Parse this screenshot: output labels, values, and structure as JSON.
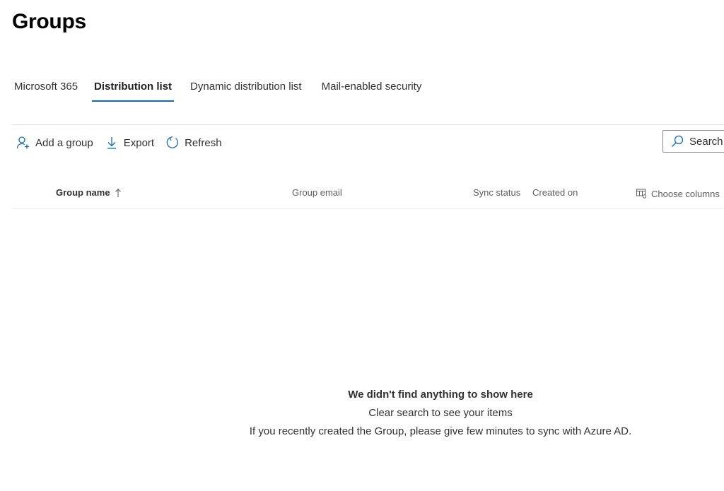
{
  "page": {
    "title": "Groups"
  },
  "tabs": [
    {
      "label": "Microsoft 365",
      "active": false
    },
    {
      "label": "Distribution list",
      "active": true
    },
    {
      "label": "Dynamic distribution list",
      "active": false
    },
    {
      "label": "Mail-enabled security",
      "active": false
    }
  ],
  "toolbar": {
    "add_group_label": "Add a group",
    "add_group_icon": "add-person-icon",
    "export_label": "Export",
    "export_icon": "download-icon",
    "refresh_label": "Refresh",
    "refresh_icon": "refresh-icon"
  },
  "search": {
    "label": "Search",
    "icon": "search-icon"
  },
  "table": {
    "columns": [
      {
        "label": "Group name",
        "sorted": "ascending"
      },
      {
        "label": "Group email"
      },
      {
        "label": "Sync status"
      },
      {
        "label": "Created on"
      }
    ],
    "choose_columns_label": "Choose columns",
    "choose_columns_icon": "columns-icon"
  },
  "empty_state": {
    "title": "We didn't find anything to show here",
    "line1": "Clear search to see your items",
    "line2": "If you recently created the Group, please give few minutes to sync with Azure AD."
  },
  "colors": {
    "accent": "#0f6cbd",
    "text": "#323130",
    "secondary_text": "#605e5c",
    "divider": "#e1dfdd"
  }
}
